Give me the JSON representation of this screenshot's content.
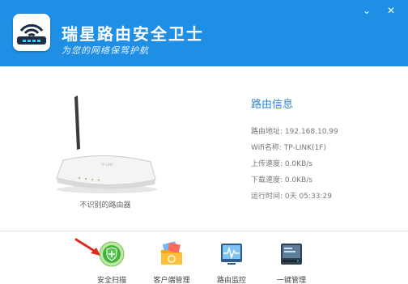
{
  "app": {
    "title": "瑞星路由安全卫士",
    "subtitle": "为您的网络保驾护航"
  },
  "window_controls": {
    "minimize": "⌄",
    "close": "✕"
  },
  "router": {
    "caption": "不识别的路由器"
  },
  "info": {
    "title": "路由信息",
    "rows": [
      {
        "label": "路由地址: ",
        "value": "192.168.10.99"
      },
      {
        "label": "Wifi名称: ",
        "value": "TP-LINK(1F)"
      },
      {
        "label": "上传速度: ",
        "value": "0.0KB/s"
      },
      {
        "label": "下载速度: ",
        "value": "0.0KB/s"
      },
      {
        "label": "运行时间: ",
        "value": "0天 05:33:29"
      }
    ]
  },
  "toolbar": {
    "items": [
      {
        "label": "安全扫描",
        "icon": "shield-scan-icon"
      },
      {
        "label": "客户端管理",
        "icon": "client-folder-icon"
      },
      {
        "label": "路由监控",
        "icon": "monitor-icon"
      },
      {
        "label": "一键管理",
        "icon": "manage-icon"
      }
    ]
  },
  "colors": {
    "header": "#1f8fe6",
    "info_title": "#2f86d6",
    "arrow": "#e02a1f"
  }
}
